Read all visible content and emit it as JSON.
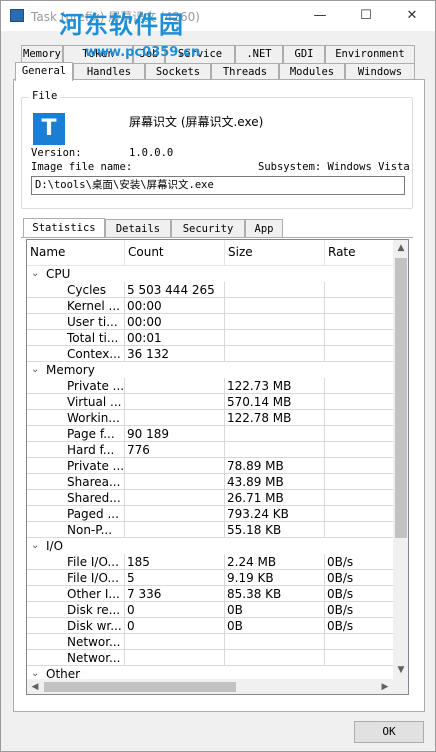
{
  "window": {
    "title": "Task (prefix) 屏幕识文 (4260)",
    "controls": {
      "minimize": "—",
      "maximize": "☐",
      "close": "✕"
    },
    "watermark": "河东软件园",
    "watermark_url": "www.pc0359.cn"
  },
  "top_tabs": {
    "row1": [
      "Memory",
      "Token",
      "Job",
      "Service",
      ".NET",
      "GDI",
      "Environment"
    ],
    "row2": [
      "General",
      "Handles",
      "Sockets",
      "Threads",
      "Modules",
      "Windows"
    ],
    "active": "General"
  },
  "file": {
    "legend": "File",
    "icon_letter": "T",
    "name": "屏幕识文 (屏幕识文.exe)",
    "version_label": "Version:",
    "version": "1.0.0.0",
    "image_file_label": "Image file name:",
    "subsystem": "Subsystem: Windows Vista",
    "path": "D:\\tools\\桌面\\安装\\屏幕识文.exe"
  },
  "sub_tabs": {
    "items": [
      "Statistics",
      "Details",
      "Security",
      "App"
    ],
    "active": "Statistics"
  },
  "table": {
    "columns": [
      "Name",
      "Count",
      "Size",
      "Rate"
    ],
    "rows": [
      {
        "group": true,
        "name": "CPU"
      },
      {
        "name": "Cycles",
        "count": "5 503 444 265",
        "size": "",
        "rate": ""
      },
      {
        "name": "Kernel ...",
        "count": "00:00",
        "size": "",
        "rate": ""
      },
      {
        "name": "User ti...",
        "count": "00:00",
        "size": "",
        "rate": ""
      },
      {
        "name": "Total ti...",
        "count": "00:01",
        "size": "",
        "rate": ""
      },
      {
        "name": "Contex...",
        "count": "36 132",
        "size": "",
        "rate": ""
      },
      {
        "group": true,
        "name": "Memory"
      },
      {
        "name": "Private ...",
        "count": "",
        "size": "122.73 MB",
        "rate": ""
      },
      {
        "name": "Virtual ...",
        "count": "",
        "size": "570.14 MB",
        "rate": ""
      },
      {
        "name": "Workin...",
        "count": "",
        "size": "122.78 MB",
        "rate": ""
      },
      {
        "name": "Page f...",
        "count": "90 189",
        "size": "",
        "rate": ""
      },
      {
        "name": "Hard f...",
        "count": "776",
        "size": "",
        "rate": ""
      },
      {
        "name": "Private ...",
        "count": "",
        "size": "78.89 MB",
        "rate": ""
      },
      {
        "name": "Sharea...",
        "count": "",
        "size": "43.89 MB",
        "rate": ""
      },
      {
        "name": "Shared...",
        "count": "",
        "size": "26.71 MB",
        "rate": ""
      },
      {
        "name": "Paged ...",
        "count": "",
        "size": "793.24 KB",
        "rate": ""
      },
      {
        "name": "Non-P...",
        "count": "",
        "size": "55.18 KB",
        "rate": ""
      },
      {
        "group": true,
        "name": "I/O"
      },
      {
        "name": "File I/O...",
        "count": "185",
        "size": "2.24 MB",
        "rate": "0B/s"
      },
      {
        "name": "File I/O...",
        "count": "5",
        "size": "9.19 KB",
        "rate": "0B/s"
      },
      {
        "name": "Other I...",
        "count": "7 336",
        "size": "85.38 KB",
        "rate": "0B/s"
      },
      {
        "name": "Disk re...",
        "count": "0",
        "size": "0B",
        "rate": "0B/s"
      },
      {
        "name": "Disk wr...",
        "count": "0",
        "size": "0B",
        "rate": "0B/s"
      },
      {
        "name": "Networ...",
        "count": "",
        "size": "",
        "rate": ""
      },
      {
        "name": "Networ...",
        "count": "",
        "size": "",
        "rate": ""
      },
      {
        "group": true,
        "name": "Other"
      }
    ]
  },
  "ok_label": "OK",
  "scroll": {
    "up": "▲",
    "down": "▼",
    "left": "◀",
    "right": "▶"
  }
}
